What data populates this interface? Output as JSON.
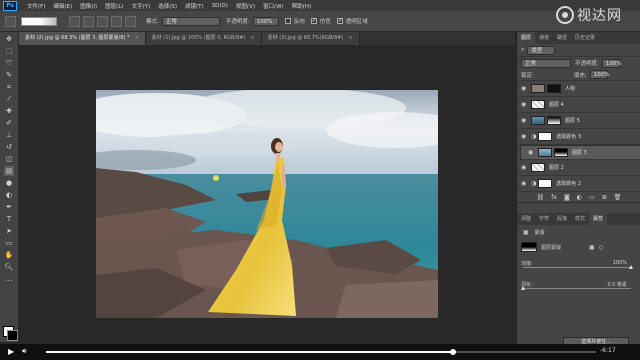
{
  "menu": {
    "app_icon": "Ps",
    "items": [
      "文件(F)",
      "编辑(E)",
      "图像(I)",
      "图层(L)",
      "文字(Y)",
      "选择(S)",
      "滤镜(T)",
      "3D(D)",
      "视图(V)",
      "窗口(W)",
      "帮助(H)"
    ]
  },
  "options": {
    "mode_label": "模式:",
    "mode_value": "正常",
    "opacity_label": "不透明度:",
    "opacity_value": "100%",
    "reverse_label": "反向",
    "dither_label": "仿色",
    "transparency_label": "透明区域"
  },
  "tabs": [
    {
      "label": "素材 (2).jpg @ 68.3% (图层 3, 图层蒙版/8) *",
      "active": true
    },
    {
      "label": "素材 (1).jpg @ 100% (图层 0, RGB/8#)",
      "active": false
    },
    {
      "label": "素材 (3).jpg @ 66.7%(RGB/8#)",
      "active": false
    }
  ],
  "watermark": "视达网",
  "panel": {
    "tabs": [
      "图层",
      "通道",
      "路径",
      "历史记录"
    ],
    "kind_label": "类型",
    "blend_value": "正常",
    "opacity_label": "不透明度:",
    "opacity_value": "100%",
    "lock_label": "锁定:",
    "fill_label": "填充:",
    "fill_value": "100%",
    "layers": [
      {
        "name": "人物",
        "selected": false
      },
      {
        "name": "图层 4",
        "selected": false
      },
      {
        "name": "图层 5",
        "selected": false
      },
      {
        "name": "选取颜色 3",
        "selected": false
      },
      {
        "name": "图层 3",
        "selected": true
      },
      {
        "name": "图层 2",
        "selected": false
      },
      {
        "name": "选取颜色 2",
        "selected": false
      }
    ],
    "props_tabs": [
      "调整",
      "字符",
      "段落",
      "样式",
      "属性"
    ],
    "props_title": "蒙版",
    "mask_label": "图层蒙版",
    "density_label": "浓度:",
    "density_value": "100%",
    "feather_label": "羽化:",
    "feather_value": "0.0 像素",
    "select_button": "选择并遮住..."
  },
  "video": {
    "time": "-6:17",
    "progress": 0.74
  }
}
